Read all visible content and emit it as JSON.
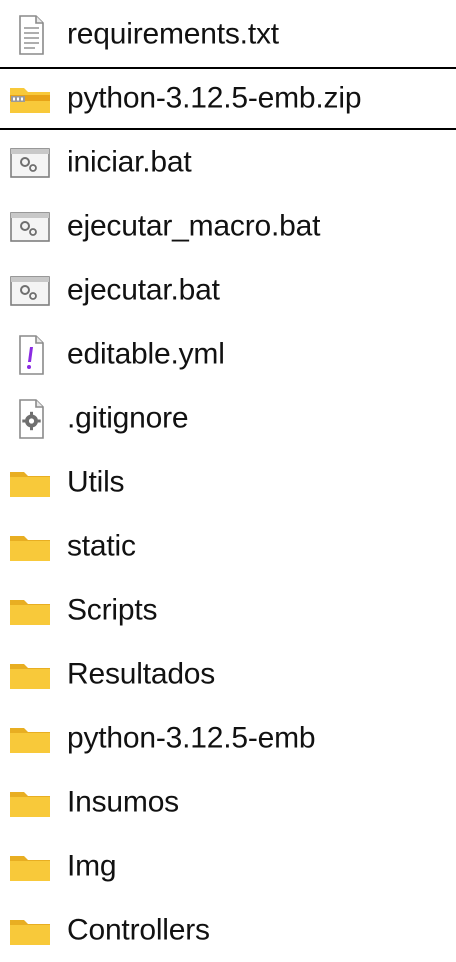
{
  "files": [
    {
      "label": "requirements.txt",
      "icon": "text-file-icon",
      "selected": false
    },
    {
      "label": "python-3.12.5-emb.zip",
      "icon": "zip-archive-icon",
      "selected": true
    },
    {
      "label": "iniciar.bat",
      "icon": "batch-file-icon",
      "selected": false
    },
    {
      "label": "ejecutar_macro.bat",
      "icon": "batch-file-icon",
      "selected": false
    },
    {
      "label": "ejecutar.bat",
      "icon": "batch-file-icon",
      "selected": false
    },
    {
      "label": "editable.yml",
      "icon": "yaml-file-icon",
      "selected": false
    },
    {
      "label": ".gitignore",
      "icon": "config-file-icon",
      "selected": false
    },
    {
      "label": "Utils",
      "icon": "folder-icon",
      "selected": false
    },
    {
      "label": "static",
      "icon": "folder-icon",
      "selected": false
    },
    {
      "label": "Scripts",
      "icon": "folder-icon",
      "selected": false
    },
    {
      "label": "Resultados",
      "icon": "folder-icon",
      "selected": false
    },
    {
      "label": "python-3.12.5-emb",
      "icon": "folder-icon",
      "selected": false
    },
    {
      "label": "Insumos",
      "icon": "folder-icon",
      "selected": false
    },
    {
      "label": "Img",
      "icon": "folder-icon",
      "selected": false
    },
    {
      "label": "Controllers",
      "icon": "folder-icon",
      "selected": false
    }
  ],
  "colors": {
    "folder": "#F8C93A",
    "folder_dark": "#E8AE22",
    "selection_border": "#000000",
    "text": "#111111",
    "yaml_accent": "#8A2BE2",
    "zip_band": "#E8A317"
  }
}
